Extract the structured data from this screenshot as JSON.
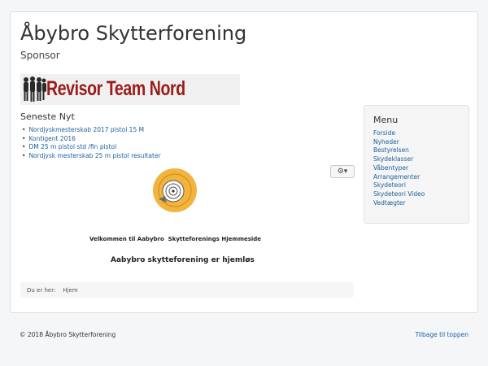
{
  "header": {
    "site_title": "Åbybro Skytterforening"
  },
  "sponsor": {
    "label": "Sponsor",
    "banner_text": "Revisor Team Nord"
  },
  "news": {
    "title": "Seneste Nyt",
    "items": [
      "Nordjyskmesterskab 2017 pistol 15 M",
      "Kontigent 2016",
      "DM 25 m pistol std /fin pistol",
      "Nordjysk mesterskab 25 m pistol resultater"
    ]
  },
  "article": {
    "gear_caret": "▾",
    "welcome": "Velkommen til Aabybro  Skytteforenings Hjemmeside",
    "homeless": "Aabybro skytteforening er hjemløs"
  },
  "breadcrumb": {
    "label": "Du er her:",
    "home": "Hjem"
  },
  "menu": {
    "title": "Menu",
    "items": [
      "Forside",
      "Nyheder",
      "Bestyrelsen",
      "Skydeklasser",
      "Våbentyper",
      "Arrangementer",
      "Skydeteori",
      "Skydeteori Video",
      "Vedtægter"
    ]
  },
  "footer": {
    "copyright": "© 2018 Åbybro Skytterforening",
    "back_to_top": "Tilbage til toppen"
  },
  "colors": {
    "link": "#1c5f9e",
    "banner_text": "#9b1a1a",
    "logo_fill": "#f2b43c"
  }
}
